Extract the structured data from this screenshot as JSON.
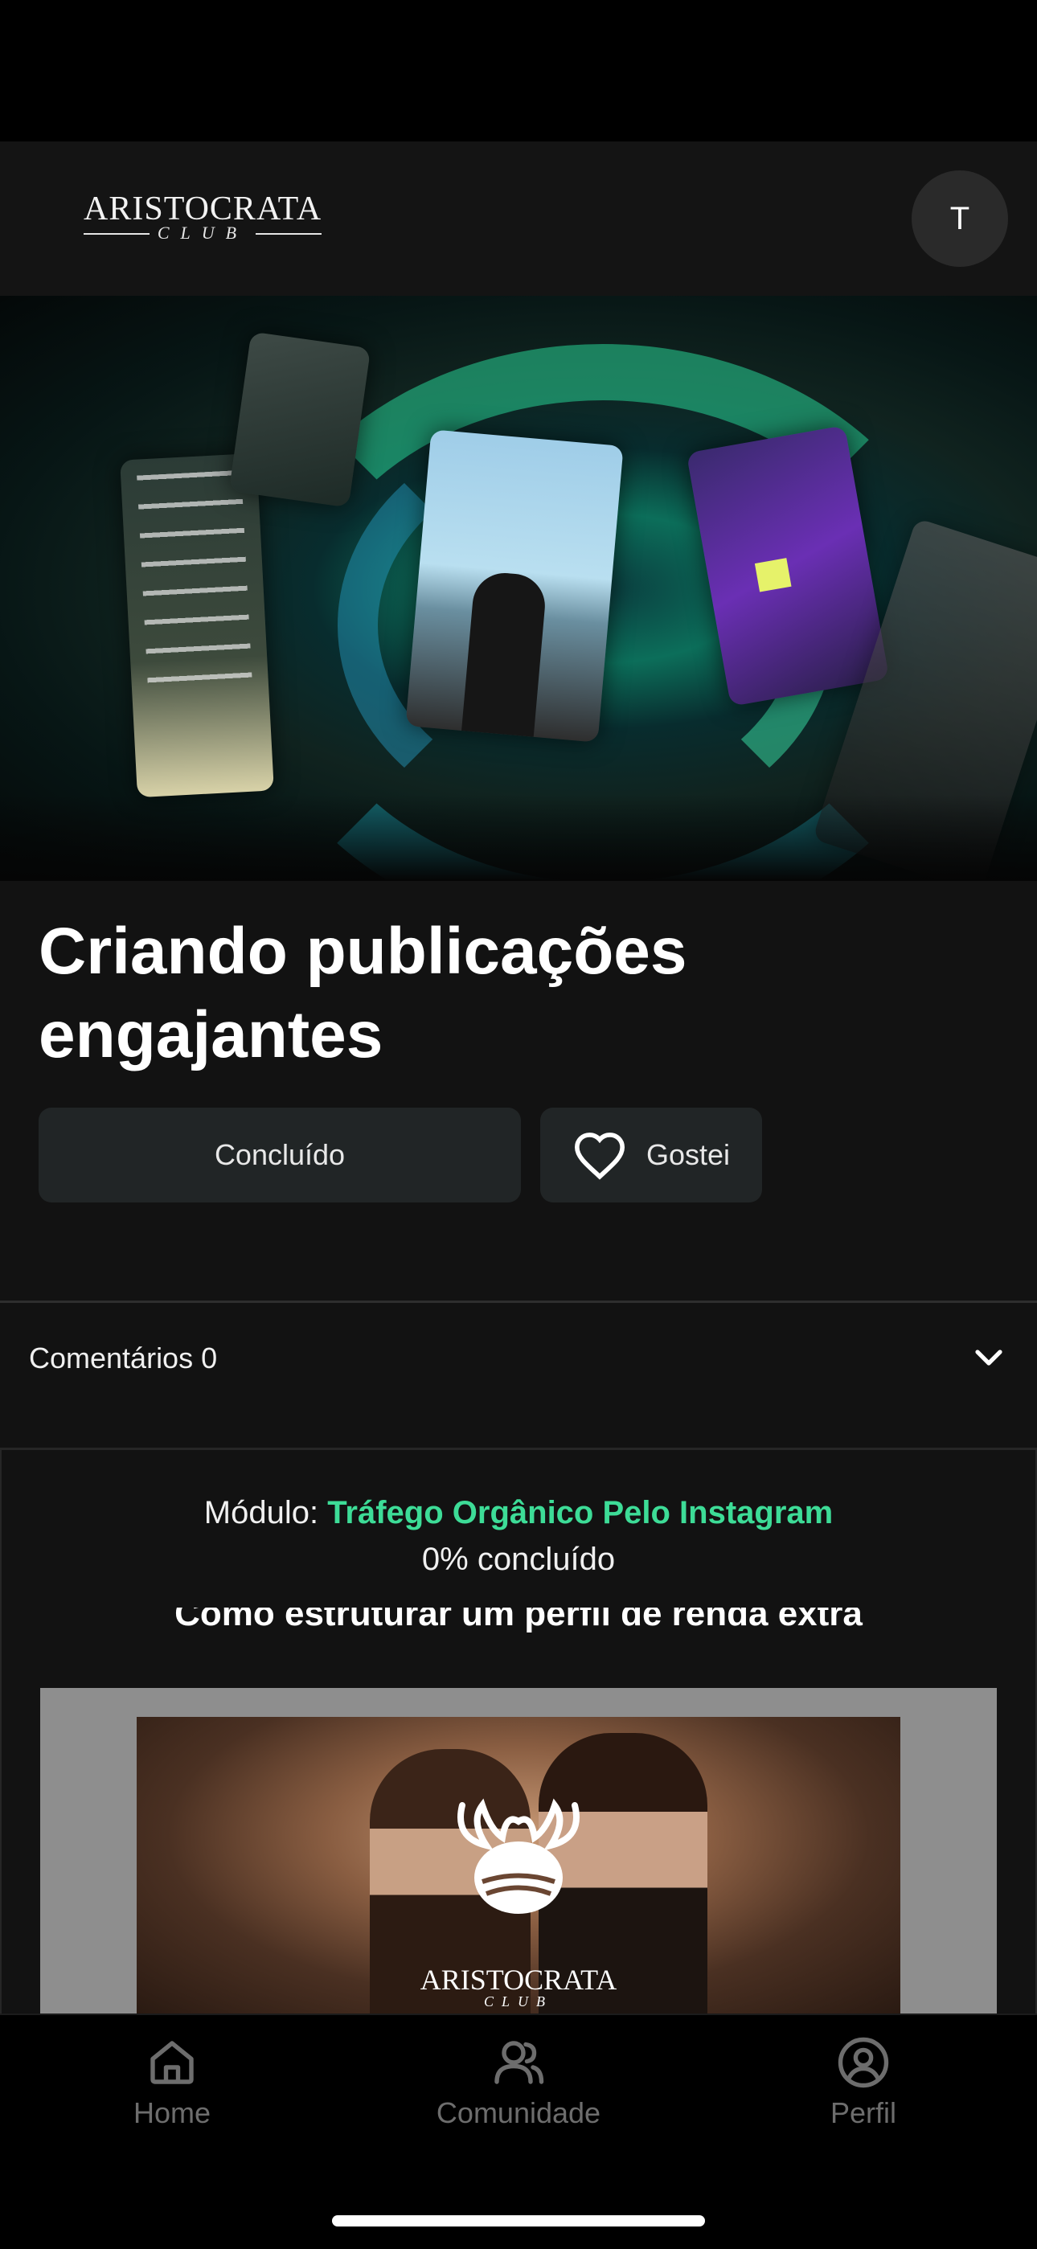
{
  "brand": {
    "name": "ARISTOCRATA",
    "sub": "CLUB"
  },
  "user": {
    "initial": "T"
  },
  "lesson": {
    "title": "Criando publicações engajantes",
    "done_label": "Concluído",
    "like_label": "Gostei"
  },
  "comments": {
    "label": "Comentários 0"
  },
  "module": {
    "prefix": "Módulo: ",
    "name": "Tráfego Orgânico Pelo Instagram",
    "progress": "0% concluído",
    "next_lesson_title": "Como estruturar um perfil de renda extra"
  },
  "thumbnail": {
    "brand_name": "ARISTOCRATA",
    "brand_sub": "CLUB"
  },
  "nav": [
    {
      "label": "Home",
      "icon": "home-icon"
    },
    {
      "label": "Comunidade",
      "icon": "users-icon"
    },
    {
      "label": "Perfil",
      "icon": "profile-icon"
    }
  ],
  "colors": {
    "accent": "#3ddc97",
    "background": "#121212",
    "button": "#212526"
  }
}
